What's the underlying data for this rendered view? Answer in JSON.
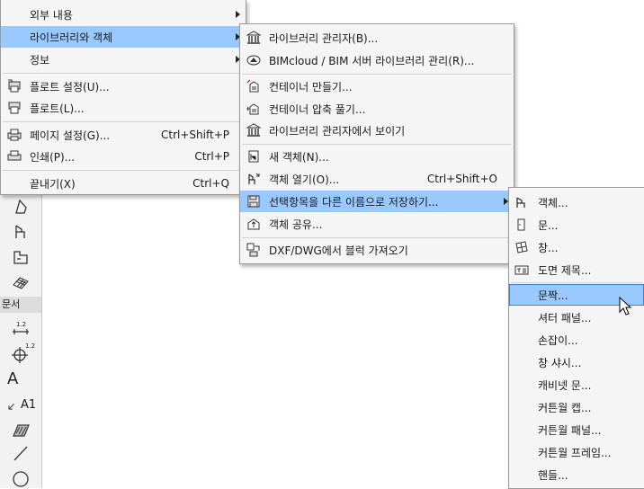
{
  "menu_main": {
    "items": [
      {
        "label": "외부 내용",
        "has_submenu": true
      },
      {
        "label": "라이브러리와 객체",
        "has_submenu": true
      },
      {
        "label": "정보",
        "has_submenu": true
      },
      {
        "label": "플로트 설정(U)..."
      },
      {
        "label": "플로트(L)..."
      },
      {
        "label": "페이지 설정(G)...",
        "shortcut": "Ctrl+Shift+P"
      },
      {
        "label": "인쇄(P)...",
        "shortcut": "Ctrl+P"
      },
      {
        "label": "끝내기(X)",
        "shortcut": "Ctrl+Q"
      }
    ]
  },
  "menu_library": {
    "items": [
      {
        "label": "라이브러리 관리자(B)..."
      },
      {
        "label": "BIMcloud / BIM 서버 라이브러리 관리(R)..."
      },
      {
        "label": "컨테이너 만들기..."
      },
      {
        "label": "컨테이너 압축 풀기..."
      },
      {
        "label": "라이브러리 관리자에서 보이기"
      },
      {
        "label": "새 객체(N)..."
      },
      {
        "label": "객체 열기(O)...",
        "shortcut": "Ctrl+Shift+O"
      },
      {
        "label": "선택항목을 다른 이름으로 저장하기...",
        "has_submenu": true
      },
      {
        "label": "객체 공유..."
      },
      {
        "label": "DXF/DWG에서 블럭 가져오기"
      }
    ]
  },
  "menu_saveas": {
    "items": [
      {
        "label": "객체..."
      },
      {
        "label": "문..."
      },
      {
        "label": "창..."
      },
      {
        "label": "도면 제목..."
      },
      {
        "label": "문짝..."
      },
      {
        "label": "셔터 패널..."
      },
      {
        "label": "손잡이..."
      },
      {
        "label": "창 샤시..."
      },
      {
        "label": "캐비넷 문..."
      },
      {
        "label": "커튼월 캡..."
      },
      {
        "label": "커튼월 패널..."
      },
      {
        "label": "커튼월 프레임..."
      },
      {
        "label": "핸들..."
      }
    ]
  },
  "toolbox": {
    "section_label": "문서",
    "dimension_tag": "1.2",
    "level_tag": "1.2",
    "text_tool": "A",
    "label_tool": "A1"
  },
  "colors": {
    "highlight": "#99c9ff",
    "menu_bg": "#f5f5f5"
  }
}
